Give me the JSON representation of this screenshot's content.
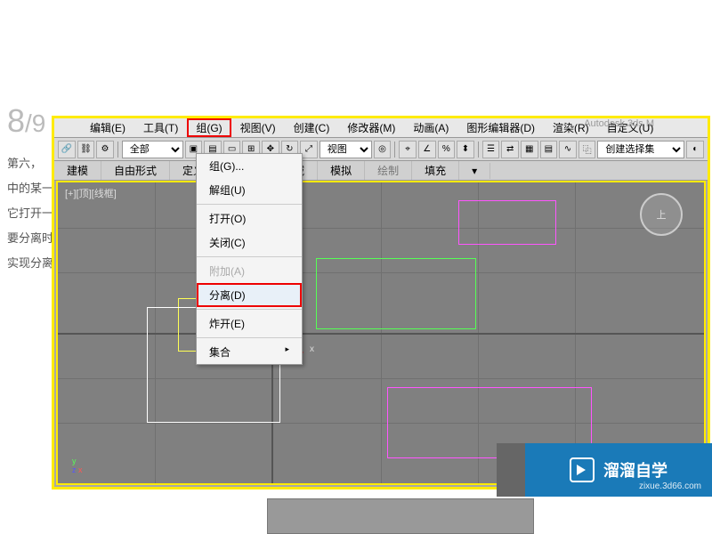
{
  "page": {
    "current": "8",
    "total": "/9"
  },
  "side_text": [
    "第六，",
    "中的某一",
    "它打开一",
    "要分离时",
    "实现分离"
  ],
  "title_remnant": "Autodesk 3ds M",
  "menubar": [
    {
      "label": "编辑(E)"
    },
    {
      "label": "工具(T)"
    },
    {
      "label": "组(G)",
      "highlighted": true
    },
    {
      "label": "视图(V)"
    },
    {
      "label": "创建(C)"
    },
    {
      "label": "修改器(M)"
    },
    {
      "label": "动画(A)"
    },
    {
      "label": "图形编辑器(D)"
    },
    {
      "label": "渲染(R)"
    },
    {
      "label": "自定义(U)"
    }
  ],
  "toolbar_selects": {
    "all": "全部",
    "view": "视图",
    "set": "创建选择集"
  },
  "ribbon": [
    {
      "label": "建模"
    },
    {
      "label": "自由形式"
    },
    {
      "label": "定义流"
    },
    {
      "label": "定义空闭区域"
    },
    {
      "label": "模拟"
    },
    {
      "label": "绘制",
      "muted": true
    },
    {
      "label": "填充"
    }
  ],
  "dropdown": [
    {
      "label": "组(G)...",
      "type": "item"
    },
    {
      "label": "解组(U)",
      "type": "item"
    },
    {
      "type": "sep"
    },
    {
      "label": "打开(O)",
      "type": "item"
    },
    {
      "label": "关闭(C)",
      "type": "item"
    },
    {
      "type": "sep"
    },
    {
      "label": "附加(A)",
      "type": "disabled"
    },
    {
      "label": "分离(D)",
      "type": "highlighted"
    },
    {
      "type": "sep"
    },
    {
      "label": "炸开(E)",
      "type": "item"
    },
    {
      "type": "sep"
    },
    {
      "label": "集合",
      "type": "submenu"
    }
  ],
  "viewport": {
    "label": "[+][顶][线框]",
    "gizmo_x": "x",
    "viewcube": "上"
  },
  "axis": {
    "y": "y",
    "z": "z",
    "x": "x"
  },
  "watermark": {
    "brand": "溜溜自学",
    "url": "zixue.3d66.com"
  }
}
